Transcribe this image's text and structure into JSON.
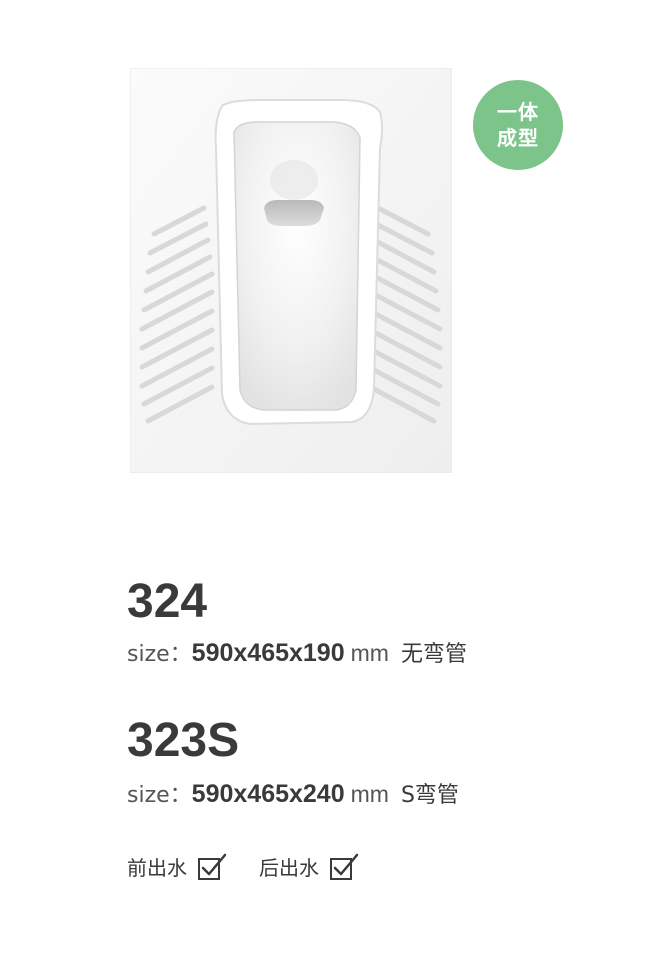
{
  "badge": {
    "line1": "一体",
    "line2": "成型"
  },
  "products": [
    {
      "model": "324",
      "size_label": "size：",
      "dimensions": "590x465x190",
      "unit": "mm",
      "type": "无弯管"
    },
    {
      "model": "323S",
      "size_label": "size：",
      "dimensions": "590x465x240",
      "unit": "mm",
      "type": "S弯管"
    }
  ],
  "outlets": [
    {
      "label": "前出水",
      "checked": true
    },
    {
      "label": "后出水",
      "checked": true
    }
  ],
  "colors": {
    "badge": "#7cc48a",
    "text": "#3a3a3a"
  }
}
